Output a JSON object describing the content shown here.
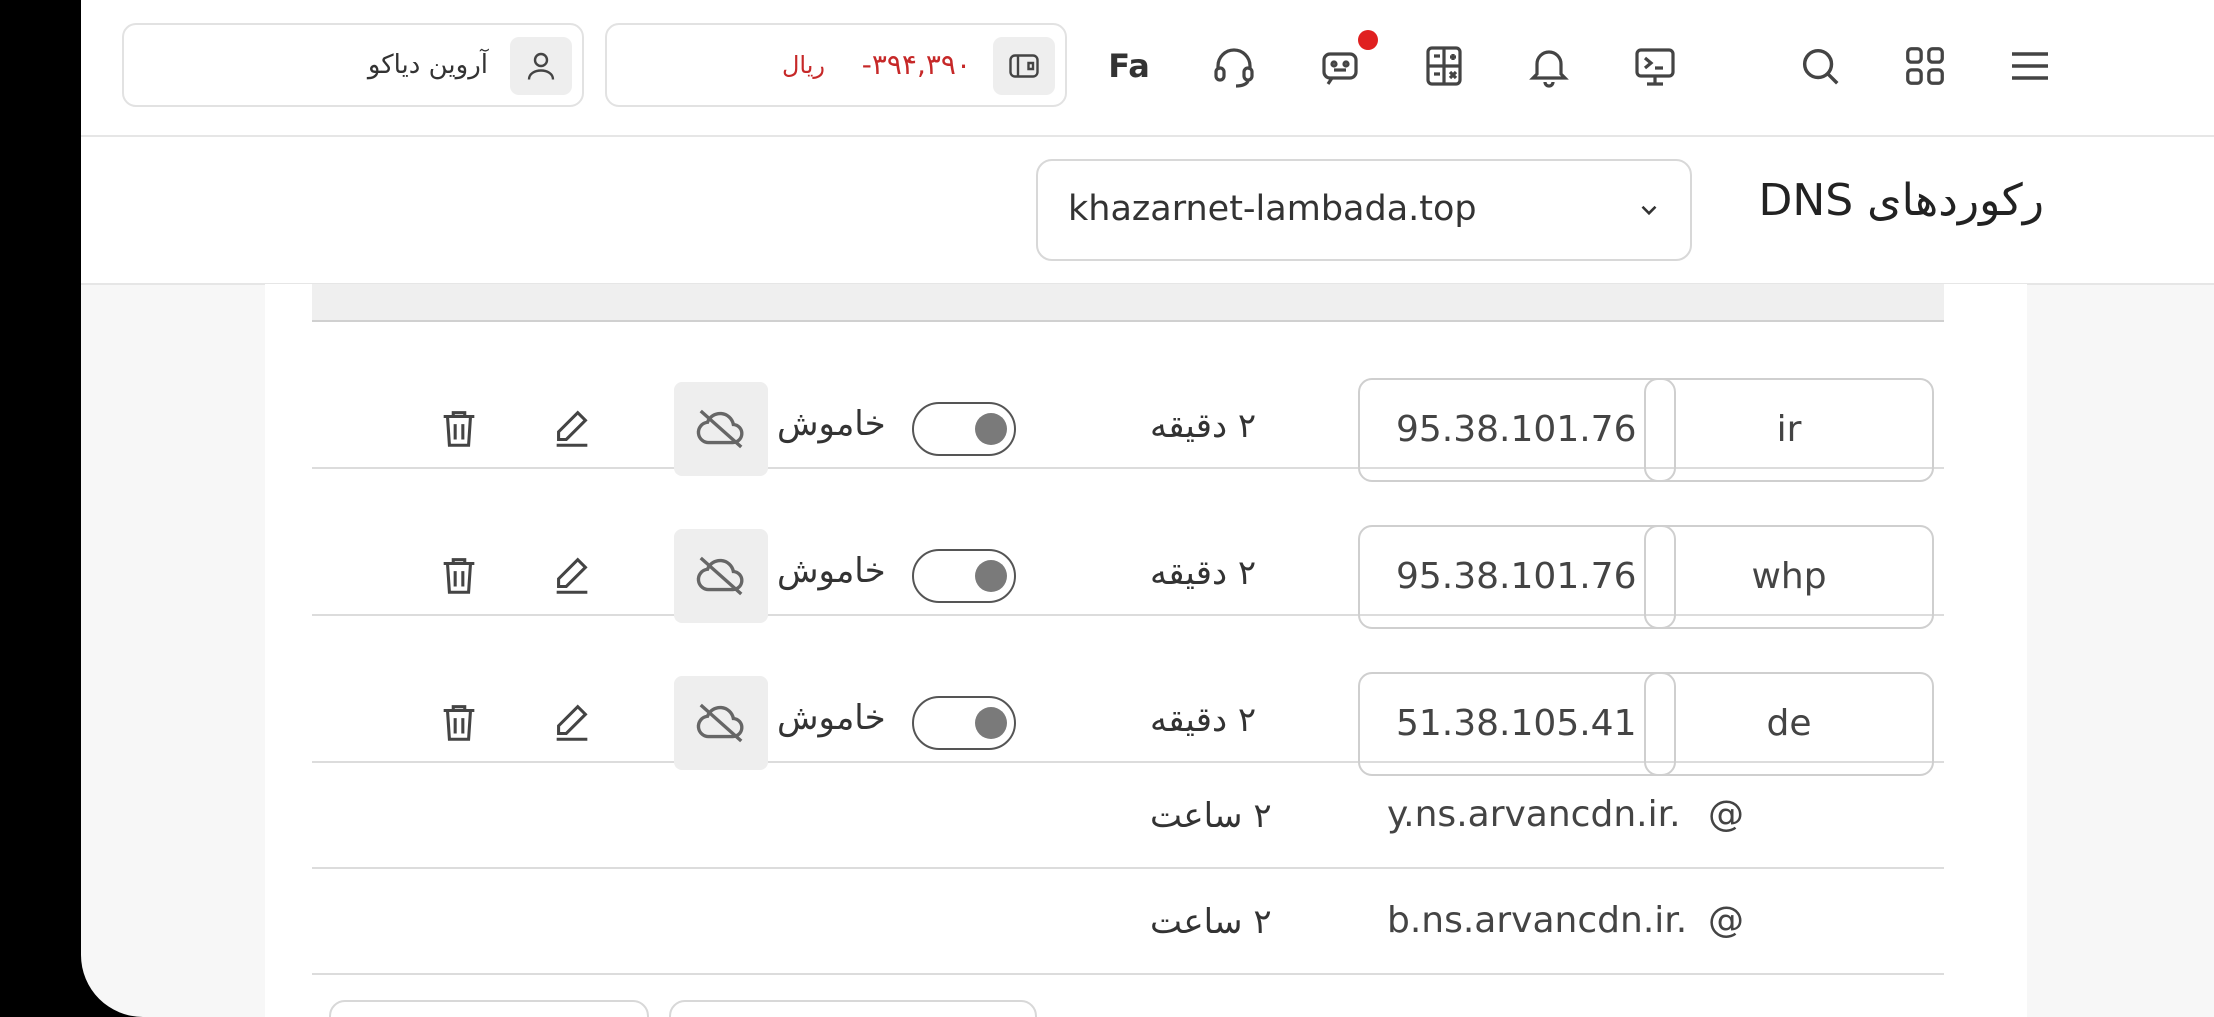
{
  "header": {
    "user_name": "آروین دیاکو",
    "balance": "-۳۹۴,۳۹۰",
    "currency": "ریال",
    "language": "Fa",
    "balance_color": "#c62828",
    "icons": [
      "menu-icon",
      "apps-grid-icon",
      "search-icon",
      "terminal-icon",
      "bell-icon",
      "calculator-icon",
      "chatbot-icon",
      "headset-icon",
      "wallet-icon",
      "user-icon"
    ]
  },
  "page": {
    "title": "رکوردهای DNS",
    "domain_selected": "khazarnet-lambada.top"
  },
  "records": [
    {
      "name": "ir",
      "value": "95.38.101.76",
      "ttl": "۲ دقیقه",
      "cloud_status": "خاموش",
      "editable": true
    },
    {
      "name": "whp",
      "value": "95.38.101.76",
      "ttl": "۲ دقیقه",
      "cloud_status": "خاموش",
      "editable": true
    },
    {
      "name": "de",
      "value": "51.38.105.41",
      "ttl": "۲ دقیقه",
      "cloud_status": "خاموش",
      "editable": true
    },
    {
      "name": "@",
      "value": "y.ns.arvancdn.ir.",
      "ttl": "۲ ساعت",
      "editable": false
    },
    {
      "name": "@",
      "value": "b.ns.arvancdn.ir.",
      "ttl": "۲ ساعت",
      "editable": false
    }
  ]
}
